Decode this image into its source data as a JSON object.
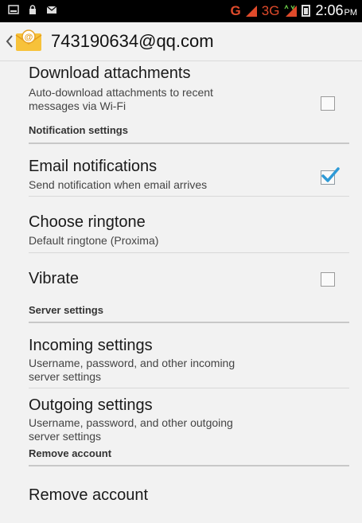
{
  "status_bar": {
    "network_g": "G",
    "network_3g": "3G",
    "time": "2:06",
    "ampm": "PM"
  },
  "action_bar": {
    "account_email": "743190634@qq.com"
  },
  "settings": {
    "download_attachments": {
      "title": "Download attachments",
      "summary_line1": "Auto-download attachments to recent",
      "summary_line2": "messages via Wi-Fi",
      "checked": false
    },
    "notification_header": "Notification settings",
    "email_notifications": {
      "title": "Email notifications",
      "summary": "Send notification when email arrives",
      "checked": true
    },
    "choose_ringtone": {
      "title": "Choose ringtone",
      "summary": "Default ringtone (Proxima)"
    },
    "vibrate": {
      "title": "Vibrate",
      "checked": false
    },
    "server_header": "Server settings",
    "incoming": {
      "title": "Incoming settings",
      "summary_line1": "Username, password, and other incoming",
      "summary_line2": "server settings"
    },
    "outgoing": {
      "title": "Outgoing settings",
      "summary_line1": "Username, password, and other outgoing",
      "summary_line2": "server settings"
    },
    "remove_header": "Remove account",
    "remove_account": {
      "title": "Remove account"
    }
  },
  "colors": {
    "status_bar_bg": "#000000",
    "signal_accent": "#e04b2b",
    "check_accent": "#2e9ad6",
    "background": "#f2f2f2"
  }
}
